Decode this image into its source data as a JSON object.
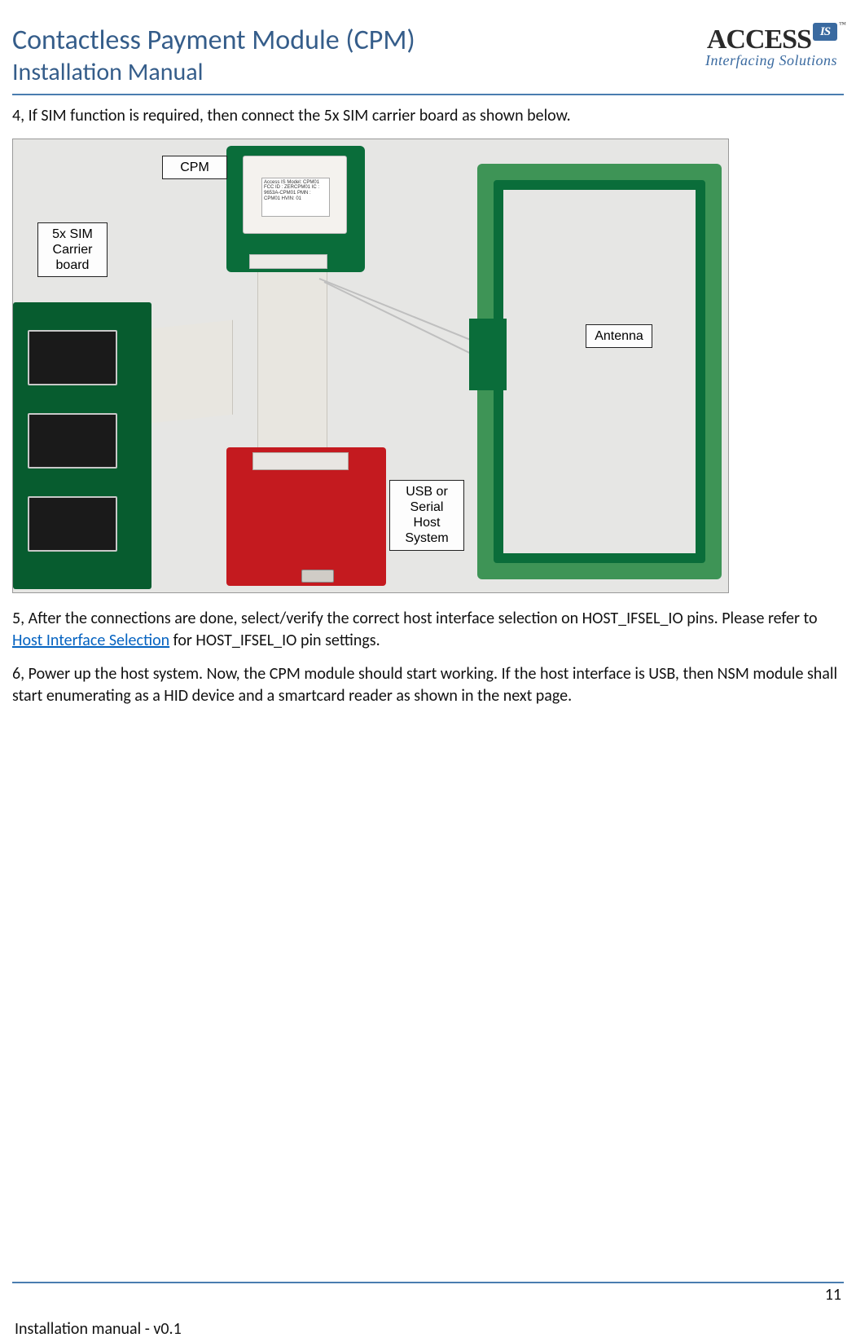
{
  "header": {
    "title": "Contactless Payment Module (CPM)",
    "subtitle": "Installation Manual",
    "logo": {
      "brand_main": "Access",
      "brand_badge": "IS",
      "tm": "™",
      "tagline": "Interfacing Solutions"
    }
  },
  "body": {
    "p4": "4, If SIM function is required, then connect the 5x SIM carrier board as shown below.",
    "p5_pre": "5, After the connections are done, select/verify the correct host interface selection on HOST_IFSEL_IO pins. Please refer to ",
    "p5_link": "Host Interface Selection",
    "p5_post": " for HOST_IFSEL_IO pin settings.",
    "p6": "6, Power up the host system. Now, the CPM module should start working. If the host interface is USB, then NSM module shall start enumerating as a HID device and a smartcard reader as shown in the next page."
  },
  "figure": {
    "callouts": {
      "cpm": "CPM",
      "sim": "5x SIM Carrier board",
      "usb": "USB or Serial Host System",
      "antenna": "Antenna"
    },
    "sticker": "Access IS\nModel: CPM01\nFCC ID : ZERCPM01\nIC : 9653A-CPM01\nPMN : CPM01 HVIN: 01"
  },
  "footer": {
    "page": "11",
    "left": "Installation manual - v0.1"
  }
}
